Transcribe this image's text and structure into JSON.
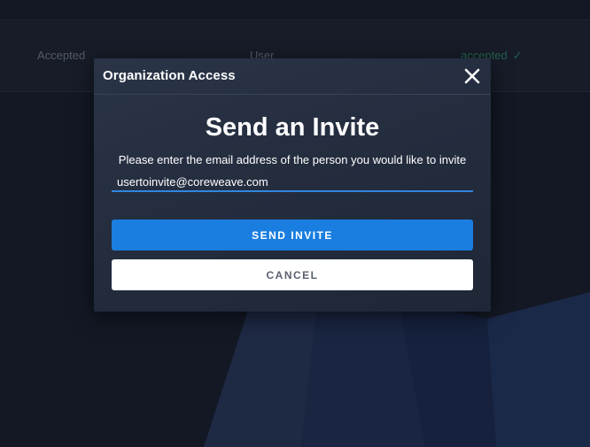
{
  "background": {
    "table_row": {
      "status_text": "Accepted",
      "role": "User",
      "state": "accepted"
    }
  },
  "modal": {
    "title": "Organization Access",
    "close_icon": "close-icon",
    "heading": "Send an Invite",
    "description": "Please enter the email address of the person you would like to invite",
    "email_value": "usertoinvite@coreweave.com",
    "send_label": "SEND INVITE",
    "cancel_label": "CANCEL"
  },
  "colors": {
    "primary": "#1a7ee0",
    "input_underline": "#2f86e0",
    "accepted_green": "#2e8f6a"
  }
}
